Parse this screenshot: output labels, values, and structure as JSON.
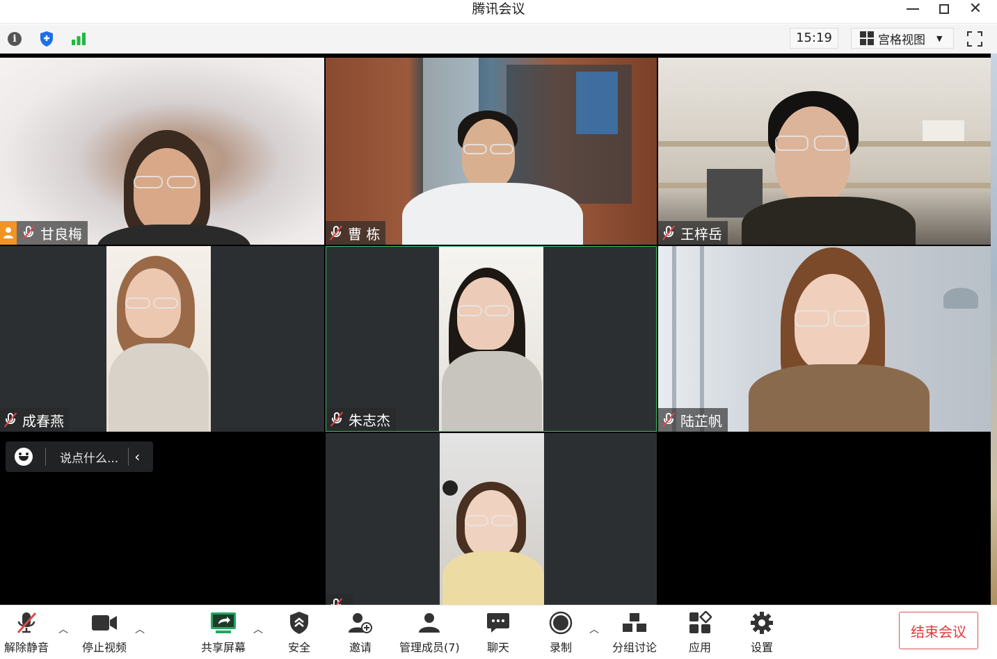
{
  "window": {
    "title": "腾讯会议"
  },
  "topbar": {
    "time": "15:19",
    "view_label": "宫格视图"
  },
  "participants": [
    {
      "name": "甘良梅",
      "muted": true,
      "host": true
    },
    {
      "name": "曹 栋",
      "muted": true,
      "host": false
    },
    {
      "name": "王梓岳",
      "muted": true,
      "host": false
    },
    {
      "name": "成春燕",
      "muted": true,
      "host": false
    },
    {
      "name": "朱志杰",
      "muted": true,
      "host": false
    },
    {
      "name": "陆芷帆",
      "muted": true,
      "host": false
    },
    {
      "name": "",
      "muted": true,
      "host": false
    }
  ],
  "chat": {
    "placeholder": "说点什么..."
  },
  "controls": {
    "unmute": "解除静音",
    "stop_video": "停止视频",
    "share_screen": "共享屏幕",
    "security": "安全",
    "invite": "邀请",
    "manage_members": "管理成员(7)",
    "chat": "聊天",
    "record": "录制",
    "breakout": "分组讨论",
    "apps": "应用",
    "settings": "设置",
    "end_meeting": "结束会议"
  },
  "colors": {
    "muted_slash": "#e64545",
    "host_badge": "#f29322",
    "active_speaker_border": "#3ec26a",
    "signal": "#1fb840",
    "shield": "#1e6fe8",
    "share_green": "#1fa860",
    "end_button": "#e03a3a"
  }
}
